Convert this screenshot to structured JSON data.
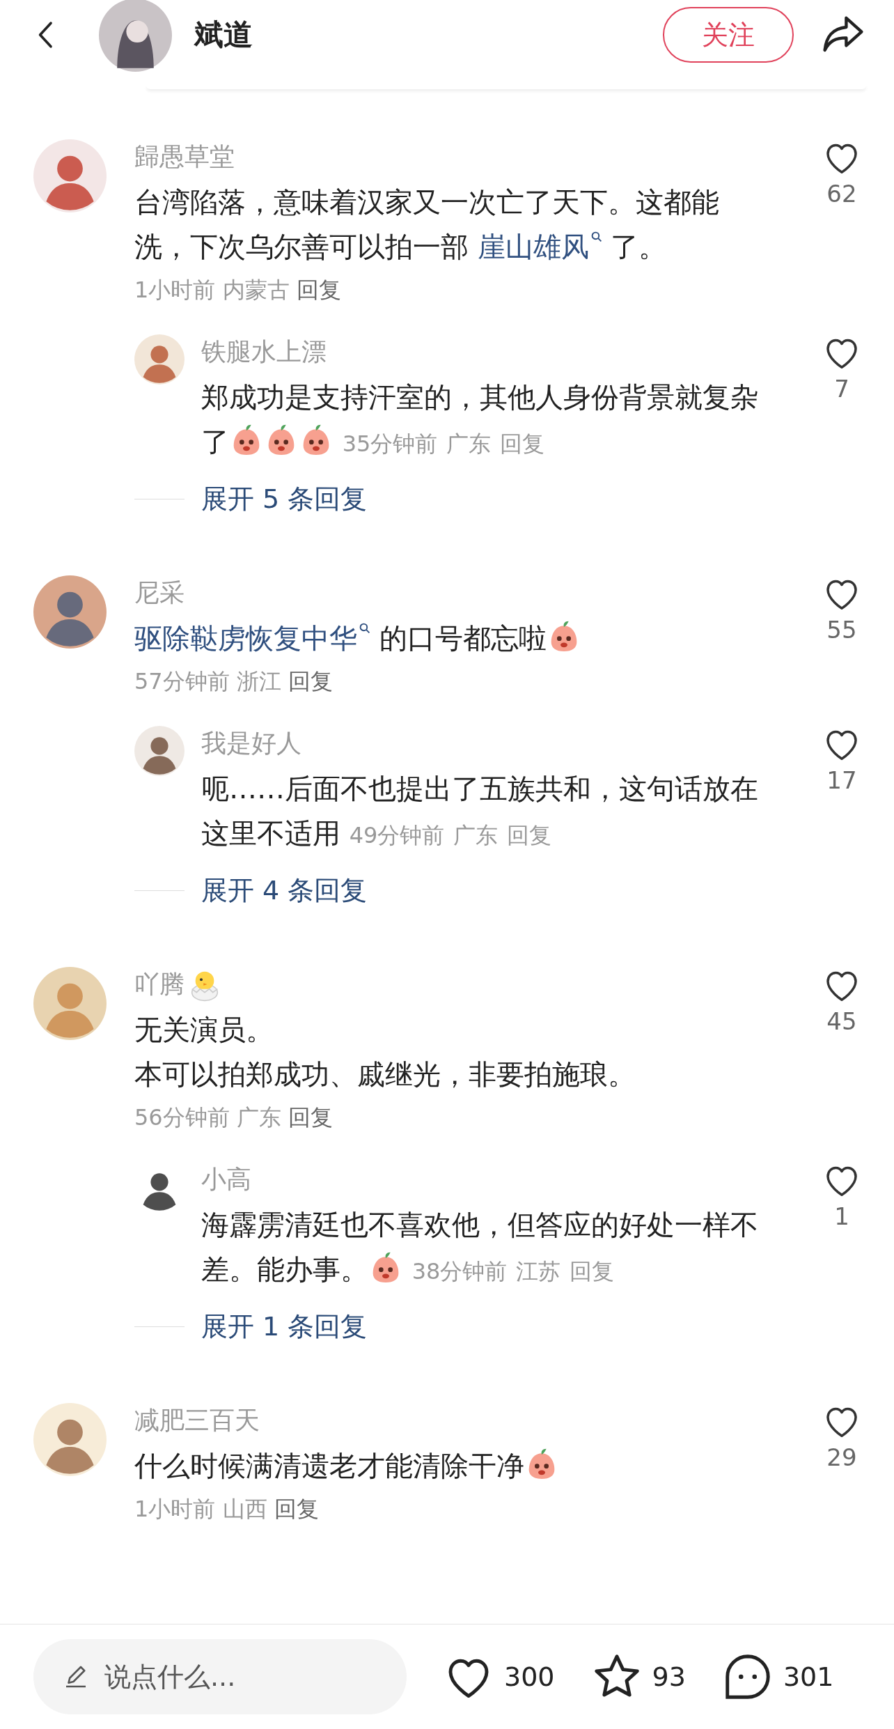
{
  "header": {
    "name": "斌道",
    "follow_button": "关注"
  },
  "comments": [
    {
      "user": "歸愚草堂",
      "name_sticker": false,
      "content": [
        {
          "kind": "text",
          "text": "台湾陷落，意味着汉家又一次亡了天下。这都能洗，下次乌尔善可以拍一部 "
        },
        {
          "kind": "link",
          "text": "崖山雄风"
        },
        {
          "kind": "text",
          "text": " 了。"
        }
      ],
      "time": "1小时前",
      "location": "内蒙古",
      "reply_label": "回复",
      "likes": "62",
      "replies": [
        {
          "user": "铁腿水上漂",
          "content": [
            {
              "kind": "text",
              "text": "郑成功是支持汗室的，其他人身份背景就复杂了"
            },
            {
              "kind": "sticker"
            },
            {
              "kind": "sticker"
            },
            {
              "kind": "sticker"
            }
          ],
          "time": "35分钟前",
          "location": "广东",
          "reply_label": "回复",
          "likes": "7"
        }
      ],
      "expand": "展开 5 条回复"
    },
    {
      "user": "尼采",
      "name_sticker": false,
      "content": [
        {
          "kind": "link",
          "text": "驱除鞑虏恢复中华"
        },
        {
          "kind": "text",
          "text": " 的口号都忘啦"
        },
        {
          "kind": "sticker"
        }
      ],
      "time": "57分钟前",
      "location": "浙江",
      "reply_label": "回复",
      "likes": "55",
      "replies": [
        {
          "user": "我是好人",
          "content": [
            {
              "kind": "text",
              "text": "呃……后面不也提出了五族共和，这句话放在这里不适用"
            }
          ],
          "time": "49分钟前",
          "location": "广东",
          "reply_label": "回复",
          "likes": "17"
        }
      ],
      "expand": "展开 4 条回复"
    },
    {
      "user": "吖腾",
      "name_sticker": true,
      "content": [
        {
          "kind": "text",
          "text": "无关演员。"
        }
      ],
      "extra_lines": [
        "本可以拍郑成功、戚继光，非要拍施琅。"
      ],
      "time": "56分钟前",
      "location": "广东",
      "reply_label": "回复",
      "likes": "45",
      "replies": [
        {
          "user": "小高",
          "content": [
            {
              "kind": "text",
              "text": "海霹雳清廷也不喜欢他，但答应的好处一样不差。能办事。"
            },
            {
              "kind": "sticker"
            }
          ],
          "time": "38分钟前",
          "location": "江苏",
          "reply_label": "回复",
          "likes": "1"
        }
      ],
      "expand": "展开 1 条回复"
    },
    {
      "user": "减肥三百天",
      "name_sticker": false,
      "content": [
        {
          "kind": "text",
          "text": "什么时候满清遗老才能清除干净"
        },
        {
          "kind": "sticker"
        }
      ],
      "time": "1小时前",
      "location": "山西",
      "reply_label": "回复",
      "likes": "29"
    }
  ],
  "bottom_bar": {
    "placeholder": "说点什么...",
    "likes": "300",
    "favorites": "93",
    "comments": "301"
  }
}
